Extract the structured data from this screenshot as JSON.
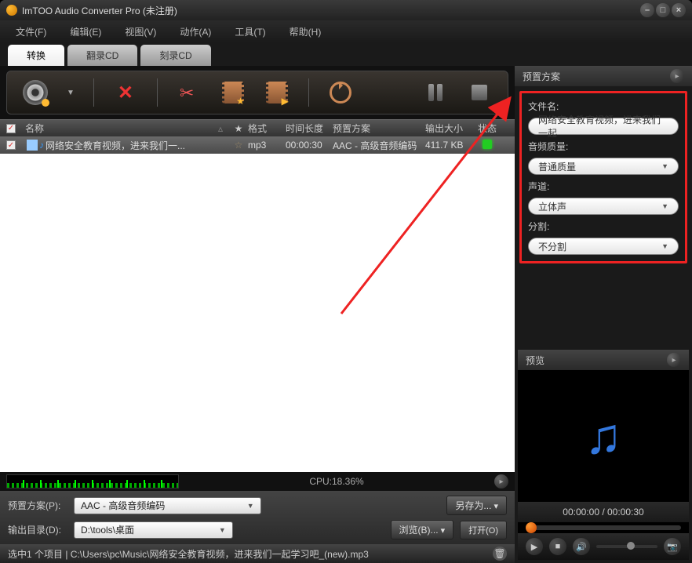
{
  "title": "ImTOO Audio Converter Pro (未注册)",
  "menu": [
    "文件(F)",
    "编辑(E)",
    "视图(V)",
    "动作(A)",
    "工具(T)",
    "帮助(H)"
  ],
  "tabs": {
    "convert": "转换",
    "rip": "翻录CD",
    "burn": "刻录CD"
  },
  "columns": {
    "name": "名称",
    "star": "★",
    "format": "格式",
    "duration": "时间长度",
    "preset": "预置方案",
    "size": "输出大小",
    "status": "状态"
  },
  "row": {
    "name": "网络安全教育视频，进来我们一...",
    "format": "mp3",
    "duration": "00:00:30",
    "preset": "AAC - 高级音频编码",
    "size": "411.7 KB"
  },
  "cpu": "CPU:18.36%",
  "presetRow": {
    "label": "预置方案(P):",
    "value": "AAC - 高级音频编码",
    "saveAs": "另存为..."
  },
  "outputRow": {
    "label": "输出目录(D):",
    "value": "D:\\tools\\桌面",
    "browse": "浏览(B)...",
    "open": "打开(O)"
  },
  "status": "选中1 个项目 | C:\\Users\\pc\\Music\\网络安全教育视频，进来我们一起学习吧_(new).mp3",
  "sidePanel": {
    "title": "预置方案",
    "filename": {
      "label": "文件名:",
      "value": "网络安全教育视频，进来我们一起"
    },
    "quality": {
      "label": "音频质量:",
      "value": "普通质量"
    },
    "channel": {
      "label": "声道:",
      "value": "立体声"
    },
    "split": {
      "label": "分割:",
      "value": "不分割"
    }
  },
  "preview": {
    "title": "预览",
    "time": "00:00:00 / 00:00:30"
  }
}
